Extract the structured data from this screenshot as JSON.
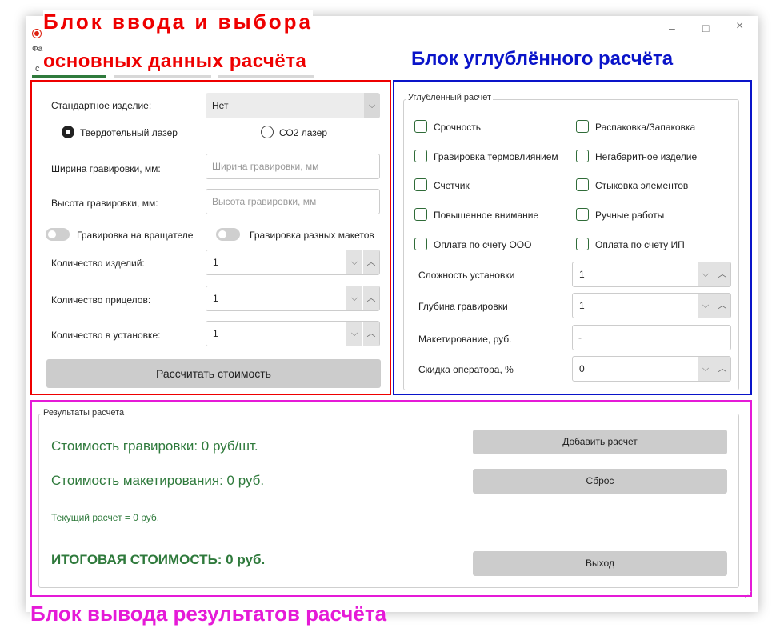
{
  "window": {
    "title_fragment": "Фа",
    "tab_fragment": "с",
    "controls": {
      "minimize": "–",
      "maximize": "□",
      "close": "×"
    }
  },
  "annotations": {
    "input_block_line1": "Блок ввода и выбора",
    "input_block_line2": "основных данных расчёта",
    "advanced_block": "Блок углублённого расчёта",
    "output_block": "Блок вывода результатов расчёта"
  },
  "main": {
    "standard_item_label": "Стандартное изделие:",
    "standard_item_value": "Нет",
    "laser_solid": "Твердотельный лазер",
    "laser_co2": "СО2 лазер",
    "width_label": "Ширина гравировки, мм:",
    "width_placeholder": "Ширина гравировки, мм",
    "height_label": "Высота гравировки, мм:",
    "height_placeholder": "Высота гравировки, мм",
    "toggle_rotator": "Гравировка на вращателе",
    "toggle_layouts": "Гравировка разных макетов",
    "qty_items_label": "Количество изделий:",
    "qty_items_value": "1",
    "qty_sights_label": "Количество прицелов:",
    "qty_sights_value": "1",
    "qty_setup_label": "Количество в установке:",
    "qty_setup_value": "1",
    "calculate_button": "Рассчитать стоимость"
  },
  "advanced": {
    "group_title": "Углубленный расчет",
    "checkboxes_left": [
      "Срочность",
      "Гравировка термовлиянием",
      "Счетчик",
      "Повышенное внимание",
      "Оплата по счету ООО"
    ],
    "checkboxes_right": [
      "Распаковка/Запаковка",
      "Негабаритное изделие",
      "Стыковка элементов",
      "Ручные работы",
      "Оплата по счету ИП"
    ],
    "setup_complexity_label": "Сложность установки",
    "setup_complexity_value": "1",
    "engraving_depth_label": "Глубина гравировки",
    "engraving_depth_value": "1",
    "layout_label": "Макетирование, руб.",
    "layout_placeholder": "-",
    "discount_label": "Скидка оператора, %",
    "discount_value": "0"
  },
  "results": {
    "group_title": "Результаты расчета",
    "engraving_cost": "Стоимость гравировки:  0  руб/шт.",
    "layout_cost": "Стоимость макетирования:  0  руб.",
    "current_calc": "Текущий расчет = 0 руб.",
    "total": "ИТОГОВАЯ СТОИМОСТЬ:  0  руб.",
    "add_button": "Добавить расчет",
    "reset_button": "Сброс",
    "exit_button": "Выход"
  },
  "colors": {
    "input_block_border": "#ee0000",
    "advanced_block_border": "#0a14c9",
    "output_block_border": "#e51ad7",
    "result_text": "#2f7a3c",
    "tab_active": "#2f7a3c"
  },
  "icons": {
    "combo_arrow": "chevron-down-icon",
    "spin_down": "chevron-down-icon",
    "spin_up": "chevron-up-icon"
  }
}
